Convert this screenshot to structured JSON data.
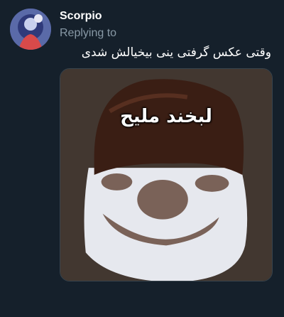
{
  "tweet": {
    "author": "Scorpio",
    "replying_label": "Replying to",
    "text": "وقتی عکس گرفتی ینی بیخیالش شدی",
    "media_caption": "لبخند مليح",
    "avatar_icon": "profile-avatar",
    "media_icon": "ice-cream-photo"
  },
  "colors": {
    "background": "#15202b",
    "secondary_text": "#8899a6",
    "border": "#38444d"
  }
}
